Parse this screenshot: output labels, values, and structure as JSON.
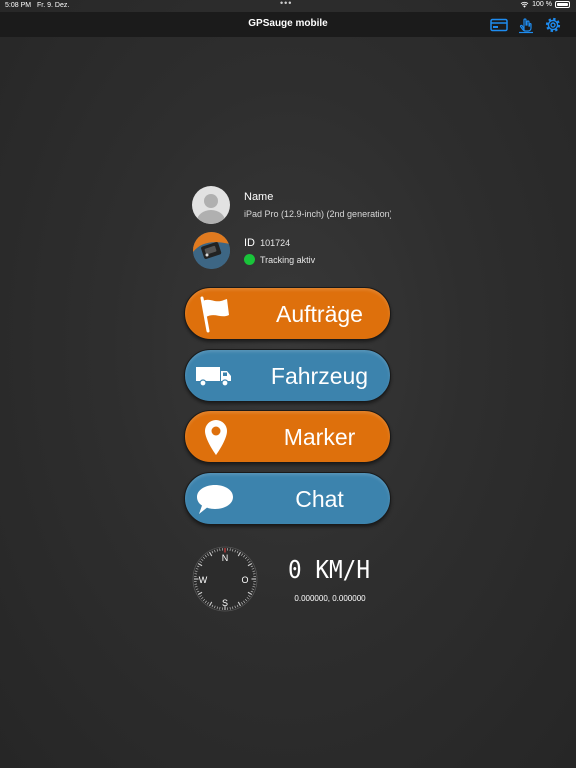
{
  "status_bar": {
    "time": "5:08 PM",
    "date": "Fr. 9. Dez.",
    "battery": "100 %"
  },
  "nav": {
    "title": "GPSauge mobile",
    "icons": [
      "card-icon",
      "hand-icon",
      "gear-icon"
    ],
    "icon_color": "#1e8cf0"
  },
  "profile": {
    "name_label": "Name",
    "device": "iPad Pro (12.9-inch) (2nd generation)",
    "id_label": "ID",
    "id_value": "101724",
    "tracking_status": "Tracking aktiv",
    "tracking_color": "#19c43a"
  },
  "buttons": [
    {
      "label": "Aufträge",
      "icon": "flag-icon",
      "color": "#de700c"
    },
    {
      "label": "Fahrzeug",
      "icon": "truck-icon",
      "color": "#3c83ad"
    },
    {
      "label": "Marker",
      "icon": "map-pin-icon",
      "color": "#de700c"
    },
    {
      "label": "Chat",
      "icon": "chat-bubble-icon",
      "color": "#3c83ad"
    }
  ],
  "compass": {
    "n": "N",
    "e": "O",
    "s": "S",
    "w": "W"
  },
  "speed": {
    "text": "0 KM/H"
  },
  "coordinates": "0.000000, 0.000000"
}
